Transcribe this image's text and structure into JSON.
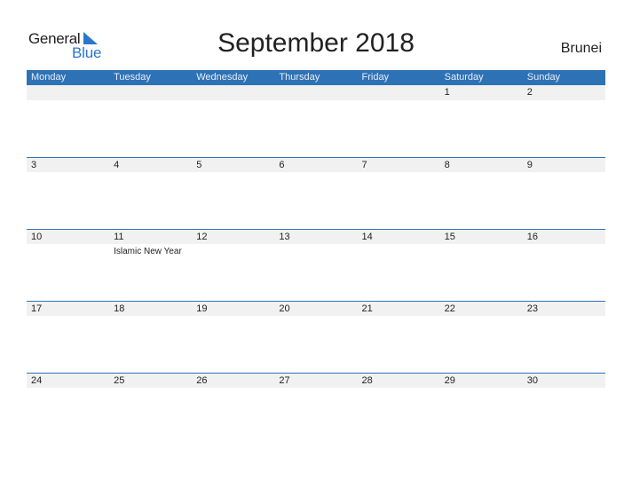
{
  "brand": {
    "line1": "General",
    "line2": "Blue",
    "accent": "#2a77c9"
  },
  "title": "September 2018",
  "country": "Brunei",
  "colors": {
    "header_bg": "#2e72b6",
    "band_bg": "#f1f1f1"
  },
  "days": [
    "Monday",
    "Tuesday",
    "Wednesday",
    "Thursday",
    "Friday",
    "Saturday",
    "Sunday"
  ],
  "weeks": [
    {
      "dates": [
        "",
        "",
        "",
        "",
        "",
        "1",
        "2"
      ],
      "holidays": [
        "",
        "",
        "",
        "",
        "",
        "",
        ""
      ]
    },
    {
      "dates": [
        "3",
        "4",
        "5",
        "6",
        "7",
        "8",
        "9"
      ],
      "holidays": [
        "",
        "",
        "",
        "",
        "",
        "",
        ""
      ]
    },
    {
      "dates": [
        "10",
        "11",
        "12",
        "13",
        "14",
        "15",
        "16"
      ],
      "holidays": [
        "",
        "Islamic New Year",
        "",
        "",
        "",
        "",
        ""
      ]
    },
    {
      "dates": [
        "17",
        "18",
        "19",
        "20",
        "21",
        "22",
        "23"
      ],
      "holidays": [
        "",
        "",
        "",
        "",
        "",
        "",
        ""
      ]
    },
    {
      "dates": [
        "24",
        "25",
        "26",
        "27",
        "28",
        "29",
        "30"
      ],
      "holidays": [
        "",
        "",
        "",
        "",
        "",
        "",
        ""
      ]
    }
  ]
}
